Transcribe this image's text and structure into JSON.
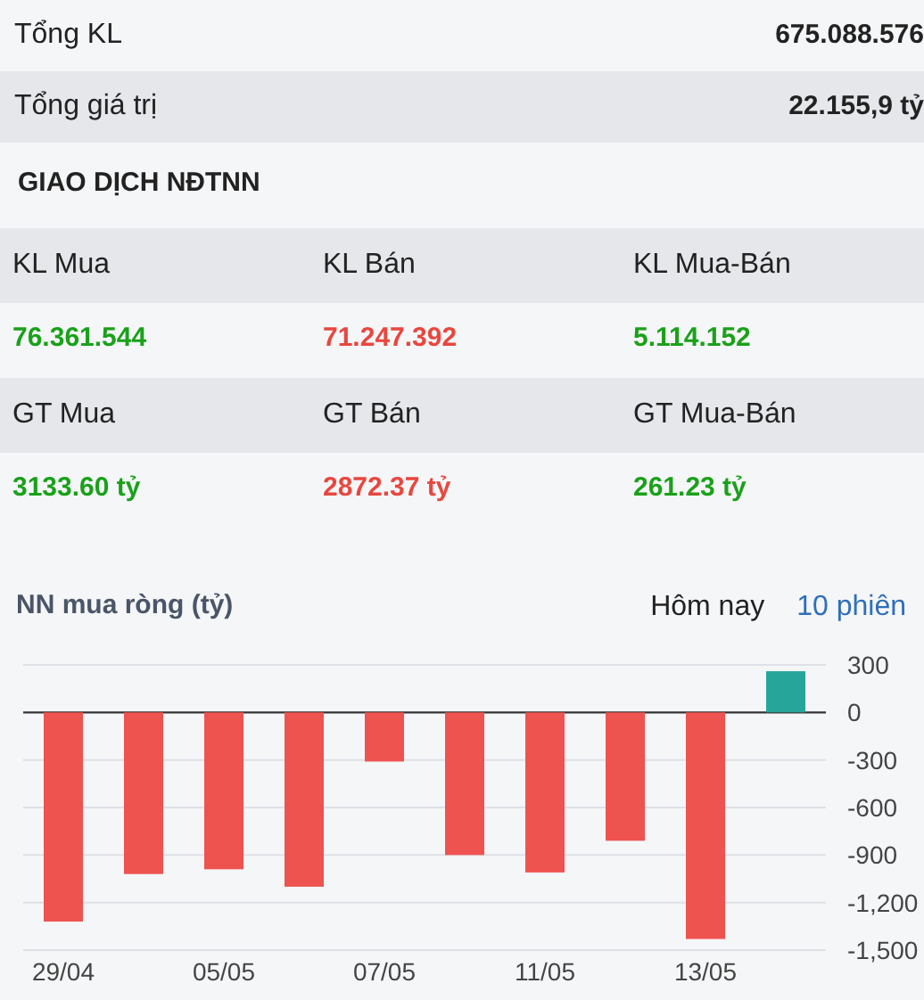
{
  "summary": [
    {
      "label": "Tổng KL",
      "value": "675.088.576"
    },
    {
      "label": "Tổng giá trị",
      "value": "22.155,9 tỷ"
    }
  ],
  "foreign_title": "GIAO DỊCH NĐTNN",
  "foreign_groups": [
    {
      "cells": [
        {
          "label": "KL Mua",
          "value": "76.361.544",
          "color": "#1aa11a"
        },
        {
          "label": "KL Bán",
          "value": "71.247.392",
          "color": "#e8473f"
        },
        {
          "label": "KL Mua-Bán",
          "value": "5.114.152",
          "color": "#1aa11a"
        }
      ]
    },
    {
      "cells": [
        {
          "label": "GT Mua",
          "value": "3133.60 tỷ",
          "color": "#1aa11a"
        },
        {
          "label": "GT Bán",
          "value": "2872.37 tỷ",
          "color": "#e8473f"
        },
        {
          "label": "GT Mua-Bán",
          "value": "261.23 tỷ",
          "color": "#1aa11a"
        }
      ]
    }
  ],
  "net_chart": {
    "title": "NN mua ròng (tỷ)",
    "tabs": [
      {
        "label": "Hôm nay",
        "selected": false
      },
      {
        "label": "10 phiên",
        "selected": true
      }
    ],
    "chart_data": {
      "type": "bar",
      "categories": [
        "29/04",
        null,
        "05/05",
        null,
        "07/05",
        null,
        "11/05",
        null,
        "13/05",
        null
      ],
      "series": [
        {
          "color": "#ef5350",
          "values": [
            -1320,
            -1020,
            -990,
            -1100,
            -310,
            -900,
            -1010,
            -810,
            -1430,
            null
          ]
        },
        {
          "color": "#26a69a",
          "values": [
            null,
            null,
            null,
            null,
            null,
            null,
            null,
            null,
            null,
            260
          ]
        }
      ],
      "grid": true,
      "ylim": [
        -1500,
        300
      ],
      "yticks": [
        {
          "value": 300,
          "label": "300"
        },
        {
          "value": 0,
          "label": "0"
        },
        {
          "value": -300,
          "label": "-300"
        },
        {
          "value": -600,
          "label": "-600"
        },
        {
          "value": -900,
          "label": "-900"
        },
        {
          "value": -1200,
          "label": "-1,200"
        },
        {
          "value": -1500,
          "label": "-1,500"
        }
      ]
    }
  }
}
